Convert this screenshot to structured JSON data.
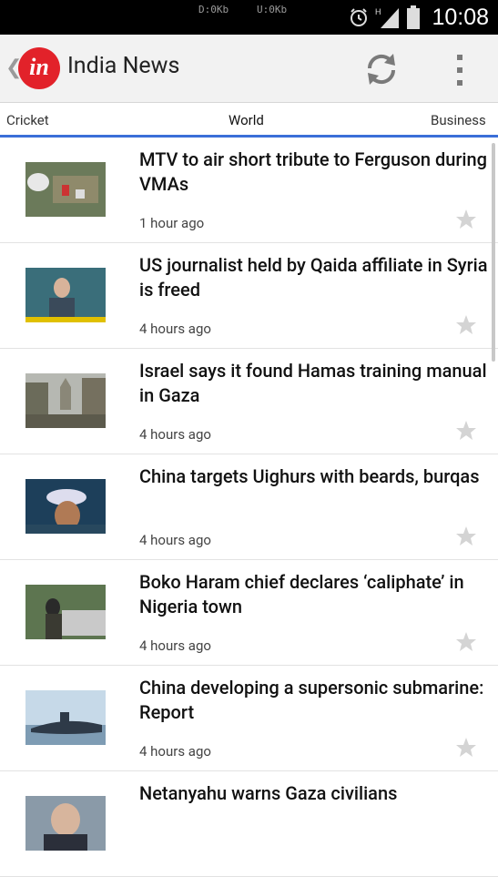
{
  "status_bar": {
    "download": "D:0Kb",
    "upload": "U:0Kb",
    "time": "10:08"
  },
  "app": {
    "title": "India News",
    "logo_text": "in",
    "back_icon": "chevron-left-icon",
    "refresh_icon": "refresh-icon",
    "overflow_icon": "more-vertical-icon"
  },
  "tabs": [
    {
      "label": "Cricket"
    },
    {
      "label": "World",
      "selected": true
    },
    {
      "label": "Business"
    }
  ],
  "accent_color": "#3b6fd8",
  "news": [
    {
      "headline": "MTV to air short tribute to Ferguson during VMAs",
      "time": "1 hour ago"
    },
    {
      "headline": "US journalist held by Qaida affiliate in Syria is freed",
      "time": "4 hours ago"
    },
    {
      "headline": "Israel says it found Hamas training manual in Gaza",
      "time": "4 hours ago"
    },
    {
      "headline": "China targets Uighurs with beards, burqas",
      "time": "4 hours ago"
    },
    {
      "headline": "Boko Haram chief declares ‘caliphate’ in Nigeria town",
      "time": "4 hours ago"
    },
    {
      "headline": "China developing a supersonic submarine: Report",
      "time": "4 hours ago"
    },
    {
      "headline": "Netanyahu warns Gaza civilians",
      "time": ""
    }
  ]
}
